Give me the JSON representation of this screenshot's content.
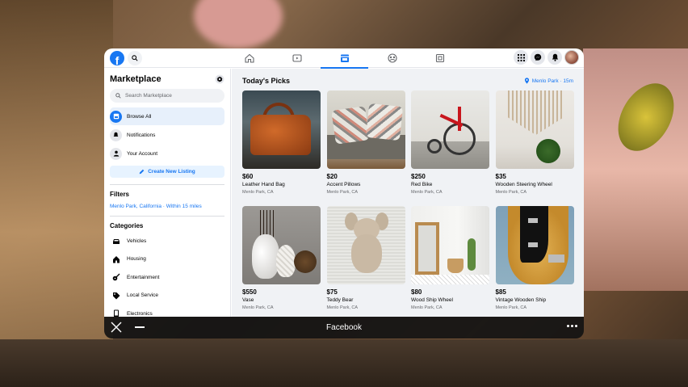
{
  "app": {
    "logo": "f",
    "window_title": "Facebook"
  },
  "topnav": {
    "tabs": [
      "home-icon",
      "watch-icon",
      "marketplace-icon",
      "groups-icon",
      "gaming-icon"
    ],
    "active_tab": "marketplace-icon",
    "right_icons": [
      "menu-grid-icon",
      "messenger-icon",
      "notifications-bell-icon",
      "profile-avatar"
    ]
  },
  "sidebar": {
    "title": "Marketplace",
    "search_placeholder": "Search Marketplace",
    "items": [
      {
        "label": "Browse All",
        "icon": "store-icon",
        "active": true
      },
      {
        "label": "Notifications",
        "icon": "bell-icon",
        "active": false
      },
      {
        "label": "Your Account",
        "icon": "person-icon",
        "active": false
      }
    ],
    "create_label": "Create New Listing",
    "filters_title": "Filters",
    "filter_location": "Menlo Park, California · Within 15 miles",
    "categories_title": "Categories",
    "categories": [
      {
        "label": "Vehicles",
        "icon": "car-icon"
      },
      {
        "label": "Housing",
        "icon": "house-icon"
      },
      {
        "label": "Entertainment",
        "icon": "guitar-icon"
      },
      {
        "label": "Local Service",
        "icon": "tag-icon"
      },
      {
        "label": "Electronics",
        "icon": "phone-icon"
      }
    ]
  },
  "main": {
    "title": "Today's Picks",
    "location": "Menlo Park · 15m",
    "listings": [
      {
        "price": "$60",
        "title": "Leather Hand Bag",
        "location": "Menlo Park, CA"
      },
      {
        "price": "$20",
        "title": "Accent Pillows",
        "location": "Menlo Park, CA"
      },
      {
        "price": "$250",
        "title": "Red Bike",
        "location": "Menlo Park, CA"
      },
      {
        "price": "$35",
        "title": "Wooden Steering Wheel",
        "location": "Menlo Park, CA"
      },
      {
        "price": "$550",
        "title": "Vase",
        "location": "Menlo Park, CA"
      },
      {
        "price": "$75",
        "title": "Teddy Bear",
        "location": "Menlo Park, CA"
      },
      {
        "price": "$80",
        "title": "Wood Ship Wheel",
        "location": "Menlo Park, CA"
      },
      {
        "price": "$85",
        "title": "Vintage Wooden Ship",
        "location": "Menlo Park, CA"
      }
    ]
  },
  "colors": {
    "accent": "#1877f2",
    "active_bg": "#e7f0fb",
    "page_bg": "#f0f2f5"
  }
}
